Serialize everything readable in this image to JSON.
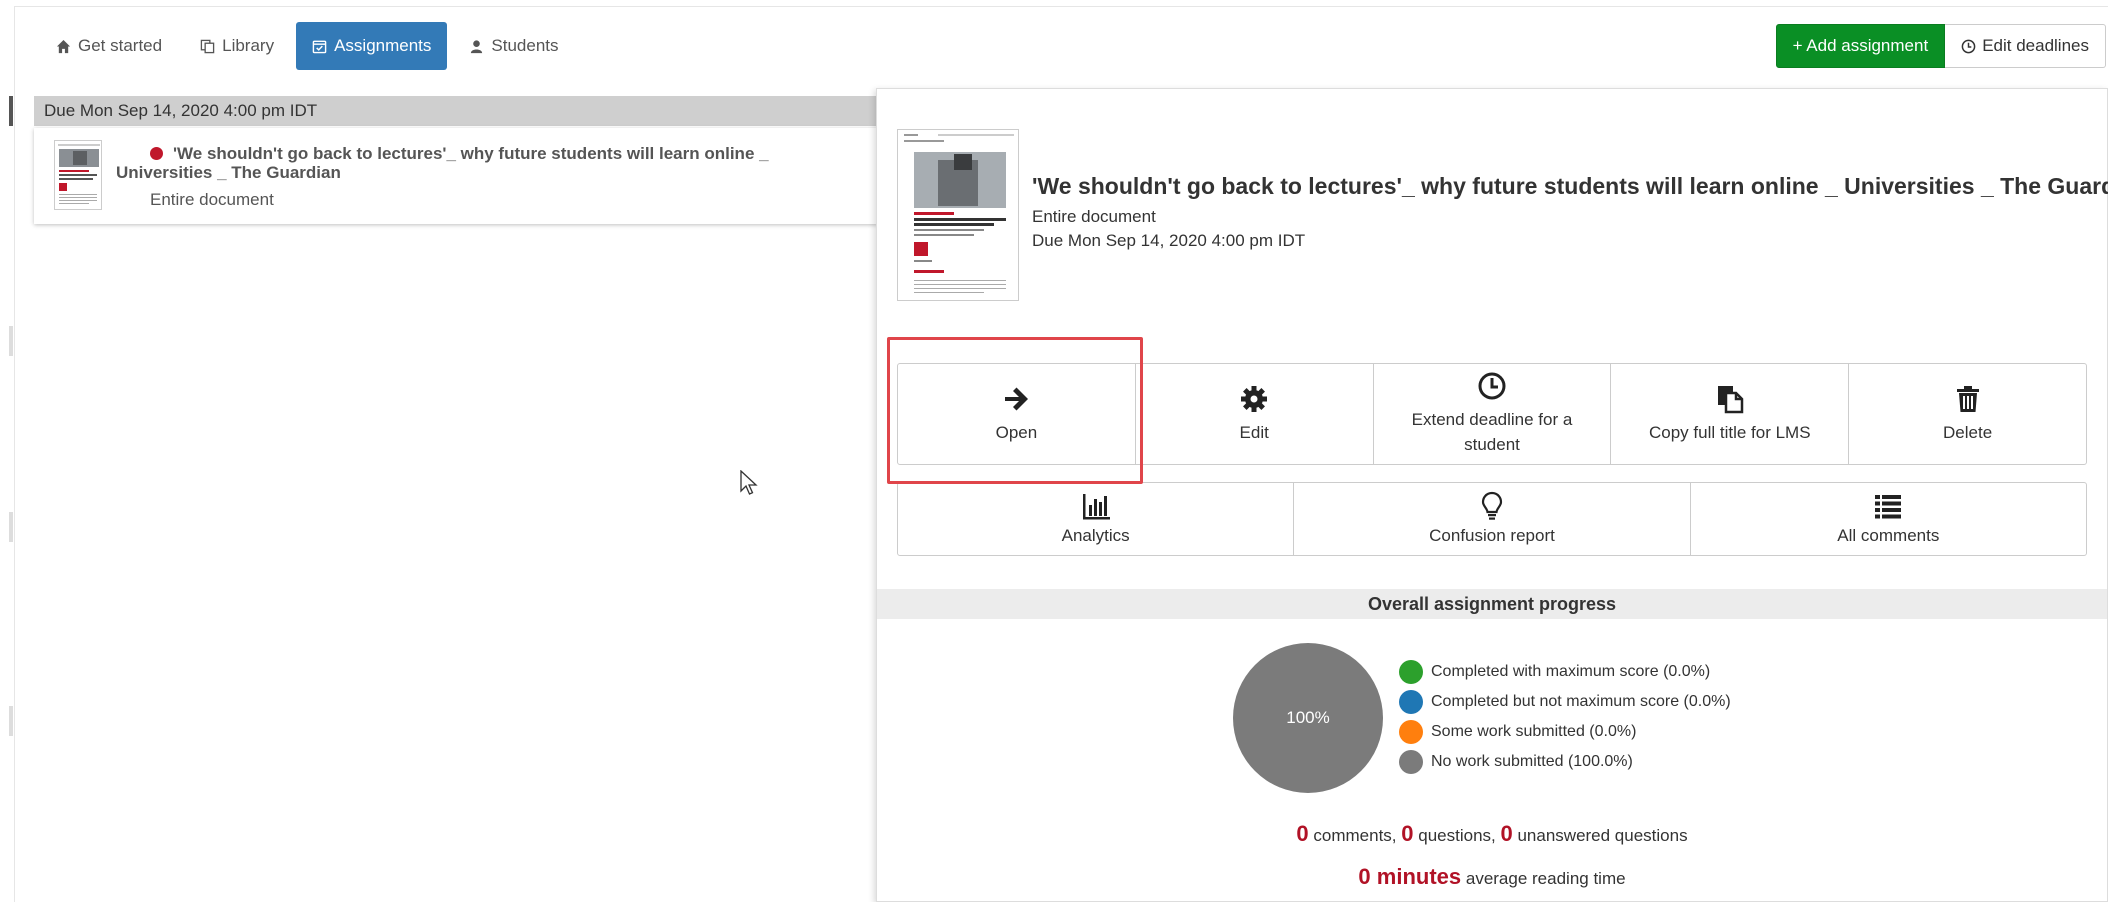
{
  "nav": {
    "tabs": [
      {
        "label": "Get started",
        "icon": "home-icon",
        "active": false
      },
      {
        "label": "Library",
        "icon": "copy-icon",
        "active": false
      },
      {
        "label": "Assignments",
        "icon": "calendar-check-icon",
        "active": true
      },
      {
        "label": "Students",
        "icon": "user-icon",
        "active": false
      }
    ],
    "add_assignment": "+ Add assignment",
    "edit_deadlines": "Edit deadlines"
  },
  "list": {
    "group_header": "Due Mon Sep 14, 2020 4:00 pm IDT",
    "card": {
      "title": "'We shouldn't go back to lectures'_ why future students will learn online _ Universities _ The Guardian",
      "subtitle": "Entire document",
      "status_color": "#c0172b"
    }
  },
  "detail": {
    "title": "'We shouldn't go back to lectures'_ why future students will learn online _ Universities _ The Guardian",
    "scope": "Entire document",
    "due": "Due Mon Sep 14, 2020 4:00 pm IDT",
    "actions": [
      {
        "label": "Open",
        "icon": "arrow-right-icon"
      },
      {
        "label": "Edit",
        "icon": "gear-icon"
      },
      {
        "label": "Extend deadline for a student",
        "icon": "clock-icon"
      },
      {
        "label": "Copy full title for LMS",
        "icon": "copy-file-icon"
      },
      {
        "label": "Delete",
        "icon": "trash-icon"
      }
    ],
    "actions2": [
      {
        "label": "Analytics",
        "icon": "bar-chart-icon"
      },
      {
        "label": "Confusion report",
        "icon": "lightbulb-icon"
      },
      {
        "label": "All comments",
        "icon": "list-icon"
      }
    ]
  },
  "progress": {
    "header": "Overall assignment progress",
    "pie_label": "100%",
    "legend": [
      {
        "label": "Completed with maximum score (0.0%)",
        "color": "#2ca02c"
      },
      {
        "label": "Completed but not maximum score (0.0%)",
        "color": "#1f77b4"
      },
      {
        "label": "Some work submitted (0.0%)",
        "color": "#ff7f0e"
      },
      {
        "label": "No work submitted (100.0%)",
        "color": "#7b7b7b"
      }
    ],
    "comments_count": "0",
    "comments_label": "comments,",
    "questions_count": "0",
    "questions_label": "questions,",
    "unanswered_count": "0",
    "unanswered_label": "unanswered questions",
    "minutes_value": "0 minutes",
    "minutes_label": "average reading time"
  }
}
